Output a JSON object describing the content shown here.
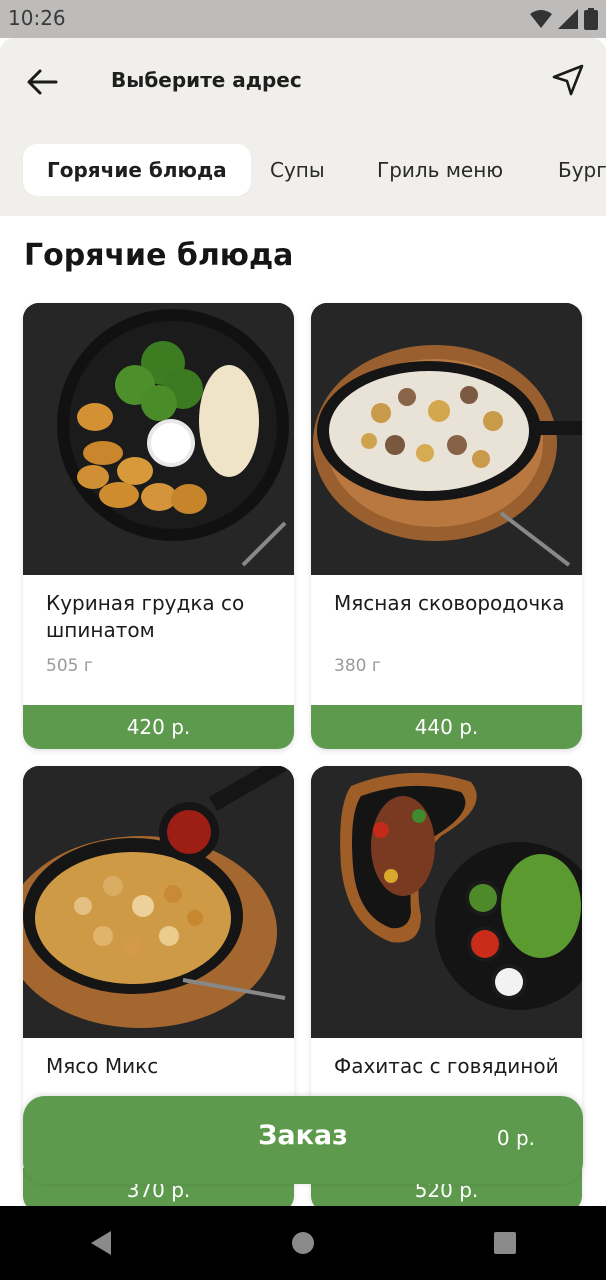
{
  "status_bar": {
    "time": "10:26"
  },
  "header": {
    "title": "Выберите адрес"
  },
  "tabs": [
    {
      "label": "Горячие блюда",
      "active": true
    },
    {
      "label": "Супы",
      "active": false
    },
    {
      "label": "Гриль меню",
      "active": false
    },
    {
      "label": "Бург",
      "active": false
    }
  ],
  "section": {
    "title": "Горячие блюда"
  },
  "products": [
    {
      "name": "Куриная грудка со шпинатом",
      "weight": "505 г",
      "price": "420 р."
    },
    {
      "name": "Мясная сковородочка",
      "weight": "380 г",
      "price": "440 р."
    },
    {
      "name": "Мясо Микс",
      "weight": "",
      "price": "370 р."
    },
    {
      "name": "Фахитас с говядиной",
      "weight": "",
      "price": "520 р."
    }
  ],
  "order": {
    "label": "Заказ",
    "sum": "0 р."
  },
  "colors": {
    "accent": "#5e9a4d",
    "header_bg": "#f1efec"
  },
  "icons": [
    "back-arrow-icon",
    "navigation-arrow-icon",
    "wifi-icon",
    "signal-icon",
    "battery-icon",
    "nav-back-icon",
    "nav-home-icon",
    "nav-recents-icon"
  ]
}
